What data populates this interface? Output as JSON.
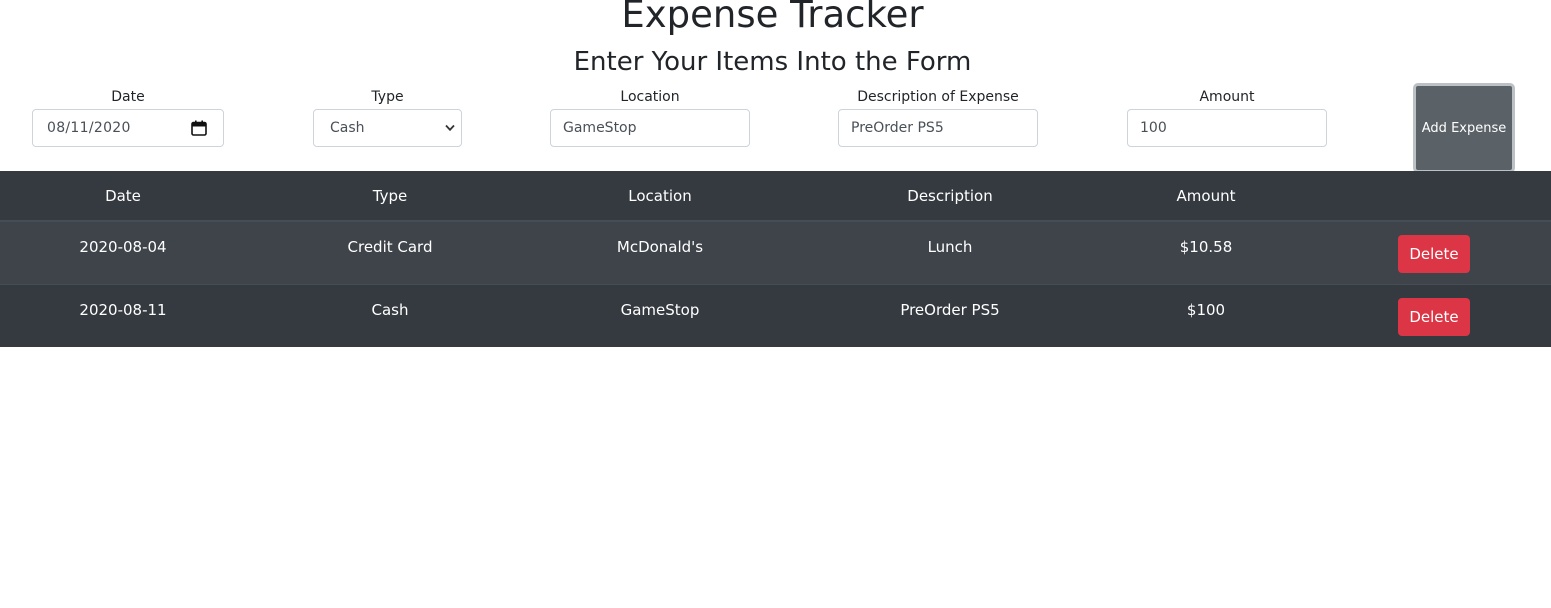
{
  "header": {
    "title": "Expense Tracker",
    "subtitle": "Enter Your Items Into the Form"
  },
  "form": {
    "date": {
      "label": "Date",
      "value": "08/11/2020"
    },
    "type": {
      "label": "Type",
      "value": "Cash"
    },
    "location": {
      "label": "Location",
      "value": "GameStop"
    },
    "description": {
      "label": "Description of Expense",
      "value": "PreOrder PS5"
    },
    "amount": {
      "label": "Amount",
      "value": "100"
    },
    "submit_label": "Add Expense"
  },
  "table": {
    "columns": [
      "Date",
      "Type",
      "Location",
      "Description",
      "Amount",
      ""
    ],
    "rows": [
      {
        "date": "2020-08-04",
        "type": "Credit Card",
        "location": "McDonald's",
        "description": "Lunch",
        "amount": "$10.58",
        "action": "Delete"
      },
      {
        "date": "2020-08-11",
        "type": "Cash",
        "location": "GameStop",
        "description": "PreOrder PS5",
        "amount": "$100",
        "action": "Delete"
      }
    ]
  },
  "colors": {
    "table_bg": "#343a40",
    "table_stripe": "#3e444a",
    "delete_button": "#dc3545",
    "add_button": "#5a6268"
  },
  "icons": {
    "date_picker": "calendar-icon",
    "select_arrow": "chevron-down-icon"
  }
}
